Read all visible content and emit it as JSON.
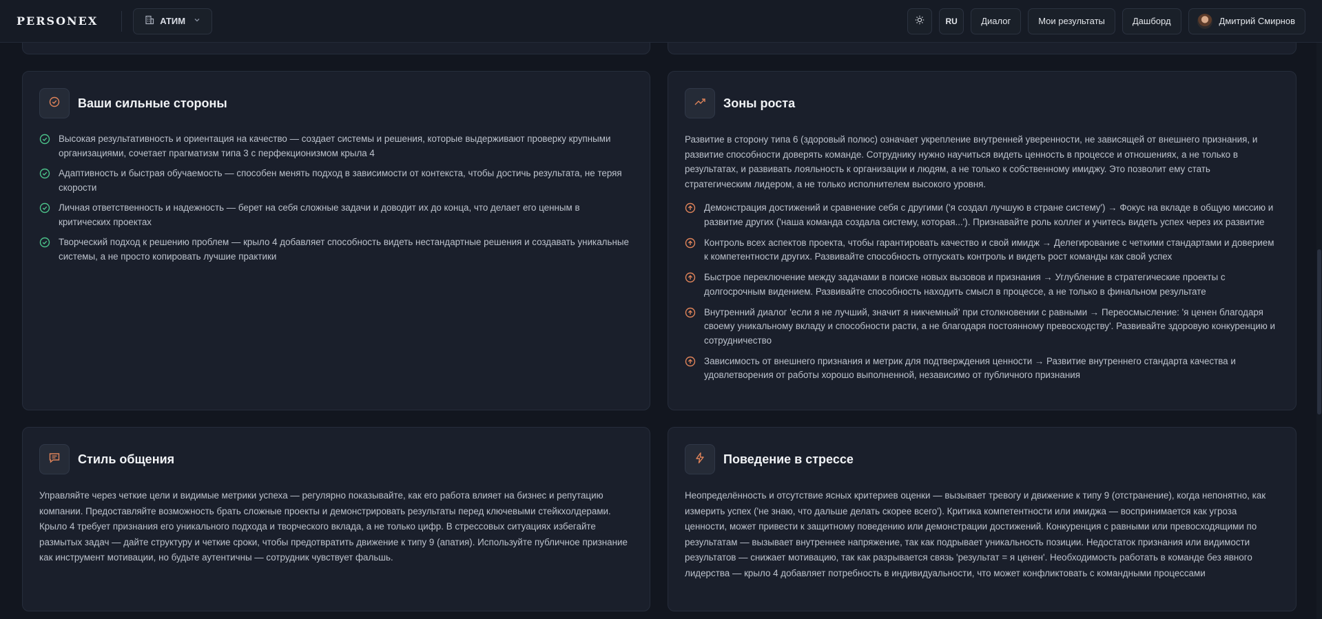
{
  "header": {
    "logo": "PERSONEX",
    "org": "АТИМ",
    "lang": "RU",
    "nav": [
      "Диалог",
      "Мои результаты",
      "Дашборд"
    ],
    "user_name": "Дмитрий Смирнов"
  },
  "strengths": {
    "title": "Ваши сильные стороны",
    "items": [
      "Высокая результативность и ориентация на качество — создает системы и решения, которые выдерживают проверку крупными организациями, сочетает прагматизм типа 3 с перфекционизмом крыла 4",
      "Адаптивность и быстрая обучаемость — способен менять подход в зависимости от контекста, чтобы достичь результата, не теряя скорости",
      "Личная ответственность и надежность — берет на себя сложные задачи и доводит их до конца, что делает его ценным в критических проектах",
      "Творческий подход к решению проблем — крыло 4 добавляет способность видеть нестандартные решения и создавать уникальные системы, а не просто копировать лучшие практики"
    ]
  },
  "growth": {
    "title": "Зоны роста",
    "intro": "Развитие в сторону типа 6 (здоровый полюс) означает укрепление внутренней уверенности, не зависящей от внешнего признания, и развитие способности доверять команде. Сотруднику нужно научиться видеть ценность в процессе и отношениях, а не только в результатах, и развивать лояльность к организации и людям, а не только к собственному имиджу. Это позволит ему стать стратегическим лидером, а не только исполнителем высокого уровня.",
    "items": [
      "Демонстрация достижений и сравнение себя с другими ('я создал лучшую в стране систему') → Фокус на вкладе в общую миссию и развитие других ('наша команда создала систему, которая...'). Признавайте роль коллег и учитесь видеть успех через их развитие",
      "Контроль всех аспектов проекта, чтобы гарантировать качество и свой имидж → Делегирование с четкими стандартами и доверием к компетентности других. Развивайте способность отпускать контроль и видеть рост команды как свой успех",
      "Быстрое переключение между задачами в поиске новых вызовов и признания → Углубление в стратегические проекты с долгосрочным видением. Развивайте способность находить смысл в процессе, а не только в финальном результате",
      "Внутренний диалог 'если я не лучший, значит я никчемный' при столкновении с равными → Переосмысление: 'я ценен благодаря своему уникальному вкладу и способности расти, а не благодаря постоянному превосходству'. Развивайте здоровую конкуренцию и сотрудничество",
      "Зависимость от внешнего признания и метрик для подтверждения ценности → Развитие внутреннего стандарта качества и удовлетворения от работы хорошо выполненной, независимо от публичного признания"
    ]
  },
  "communication": {
    "title": "Стиль общения",
    "text": "Управляйте через четкие цели и видимые метрики успеха — регулярно показывайте, как его работа влияет на бизнес и репутацию компании. Предоставляйте возможность брать сложные проекты и демонстрировать результаты перед ключевыми стейкхолдерами. Крыло 4 требует признания его уникального подхода и творческого вклада, а не только цифр. В стрессовых ситуациях избегайте размытых задач — дайте структуру и четкие сроки, чтобы предотвратить движение к типу 9 (апатия). Используйте публичное признание как инструмент мотивации, но будьте аутентичны — сотрудник чувствует фальшь."
  },
  "stress": {
    "title": "Поведение в стрессе",
    "text": "Неопределённость и отсутствие ясных критериев оценки — вызывает тревогу и движение к типу 9 (отстранение), когда непонятно, как измерить успех ('не знаю, что дальше делать скорее всего'). Критика компетентности или имиджа — воспринимается как угроза ценности, может привести к защитному поведению или демонстрации достижений. Конкуренция с равными или превосходящими по результатам — вызывает внутреннее напряжение, так как подрывает уникальность позиции. Недостаток признания или видимости результатов — снижает мотивацию, так как разрывается связь 'результат = я ценен'. Необходимость работать в команде без явного лидерства — крыло 4 добавляет потребность в индивидуальности, что может конфликтовать с командными процессами"
  },
  "colors": {
    "accent_green": "#4cc38a",
    "accent_orange": "#e0845a"
  }
}
